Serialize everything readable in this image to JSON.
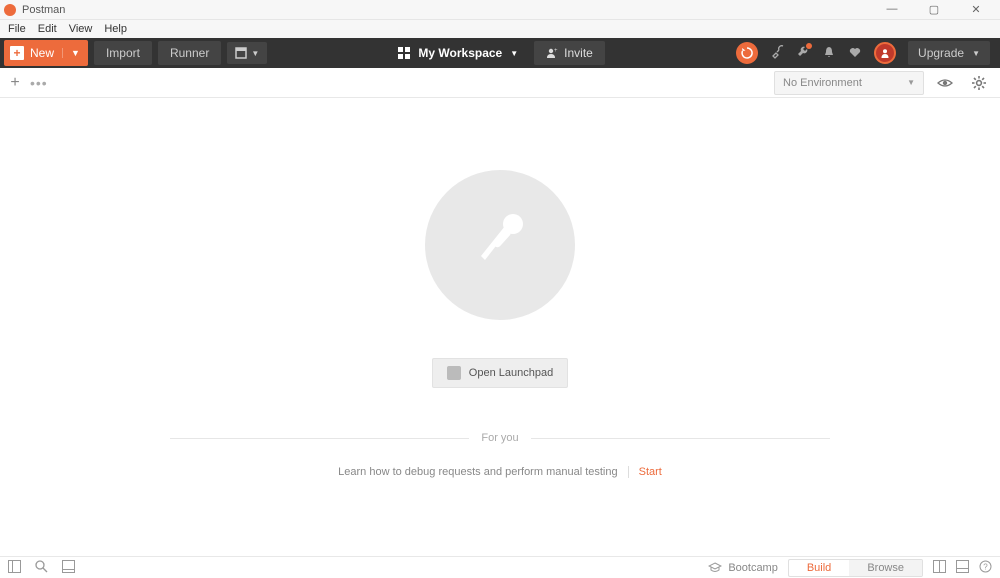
{
  "title": "Postman",
  "menubar": [
    "File",
    "Edit",
    "View",
    "Help"
  ],
  "toolbar": {
    "new_label": "New",
    "import_label": "Import",
    "runner_label": "Runner",
    "workspace_label": "My Workspace",
    "invite_label": "Invite",
    "upgrade_label": "Upgrade"
  },
  "secbar": {
    "env_label": "No Environment"
  },
  "main": {
    "launchpad_label": "Open Launchpad",
    "for_you_label": "For you",
    "tip_text": "Learn how to debug requests and perform manual testing",
    "start_label": "Start"
  },
  "statusbar": {
    "bootcamp_label": "Bootcamp",
    "build_label": "Build",
    "browse_label": "Browse"
  }
}
